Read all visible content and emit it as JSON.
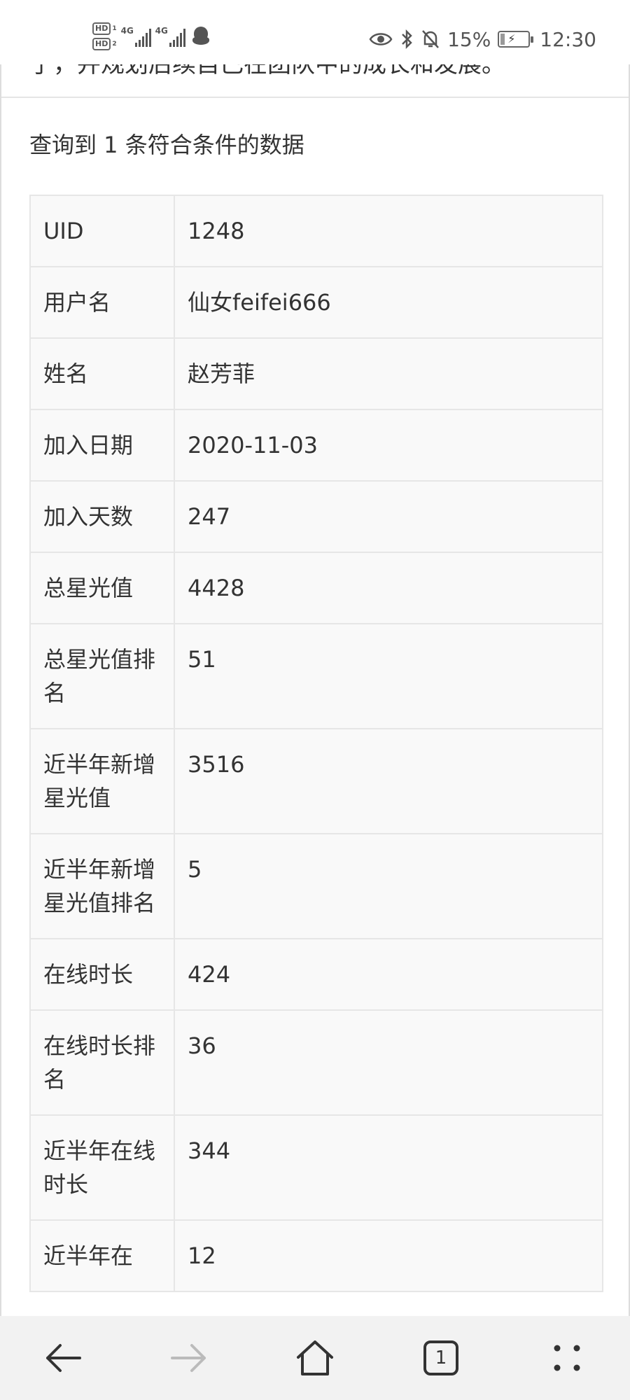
{
  "status_bar": {
    "hd1": "HD",
    "hd1_num": "1",
    "hd2": "HD",
    "hd2_num": "2",
    "net1": "4G",
    "net2": "4G",
    "battery_pct": "15%",
    "time": "12:30",
    "icons": [
      "eye-icon",
      "bluetooth-icon",
      "bell-off-icon",
      "battery-charging-icon",
      "qq-icon"
    ]
  },
  "page": {
    "top_text": "了，并规划后续自己在团队中的成长和发展。",
    "result_text": "查询到 1 条符合条件的数据"
  },
  "table": {
    "rows": [
      {
        "key": "UID",
        "value": "1248"
      },
      {
        "key": "用户名",
        "value": "仙女feifei666"
      },
      {
        "key": "姓名",
        "value": "赵芳菲"
      },
      {
        "key": "加入日期",
        "value": "2020-11-03"
      },
      {
        "key": "加入天数",
        "value": "247"
      },
      {
        "key": "总星光值",
        "value": "4428"
      },
      {
        "key": "总星光值排名",
        "value": "51"
      },
      {
        "key": "近半年新增星光值",
        "value": "3516"
      },
      {
        "key": "近半年新增星光值排名",
        "value": "5"
      },
      {
        "key": "在线时长",
        "value": "424"
      },
      {
        "key": "在线时长排名",
        "value": "36"
      },
      {
        "key": "近半年在线时长",
        "value": "344"
      },
      {
        "key": "近半年在",
        "value": "12"
      }
    ]
  },
  "nav": {
    "tab_count": "1",
    "icons": [
      "back-arrow-icon",
      "forward-arrow-icon",
      "home-icon",
      "tabs-icon",
      "more-icon"
    ]
  },
  "colors": {
    "text": "#333333",
    "table_bg": "#f9f9f9",
    "table_border": "#e6e6e6",
    "nav_bg": "#f2f2f2",
    "disabled": "#bbbbbb"
  }
}
